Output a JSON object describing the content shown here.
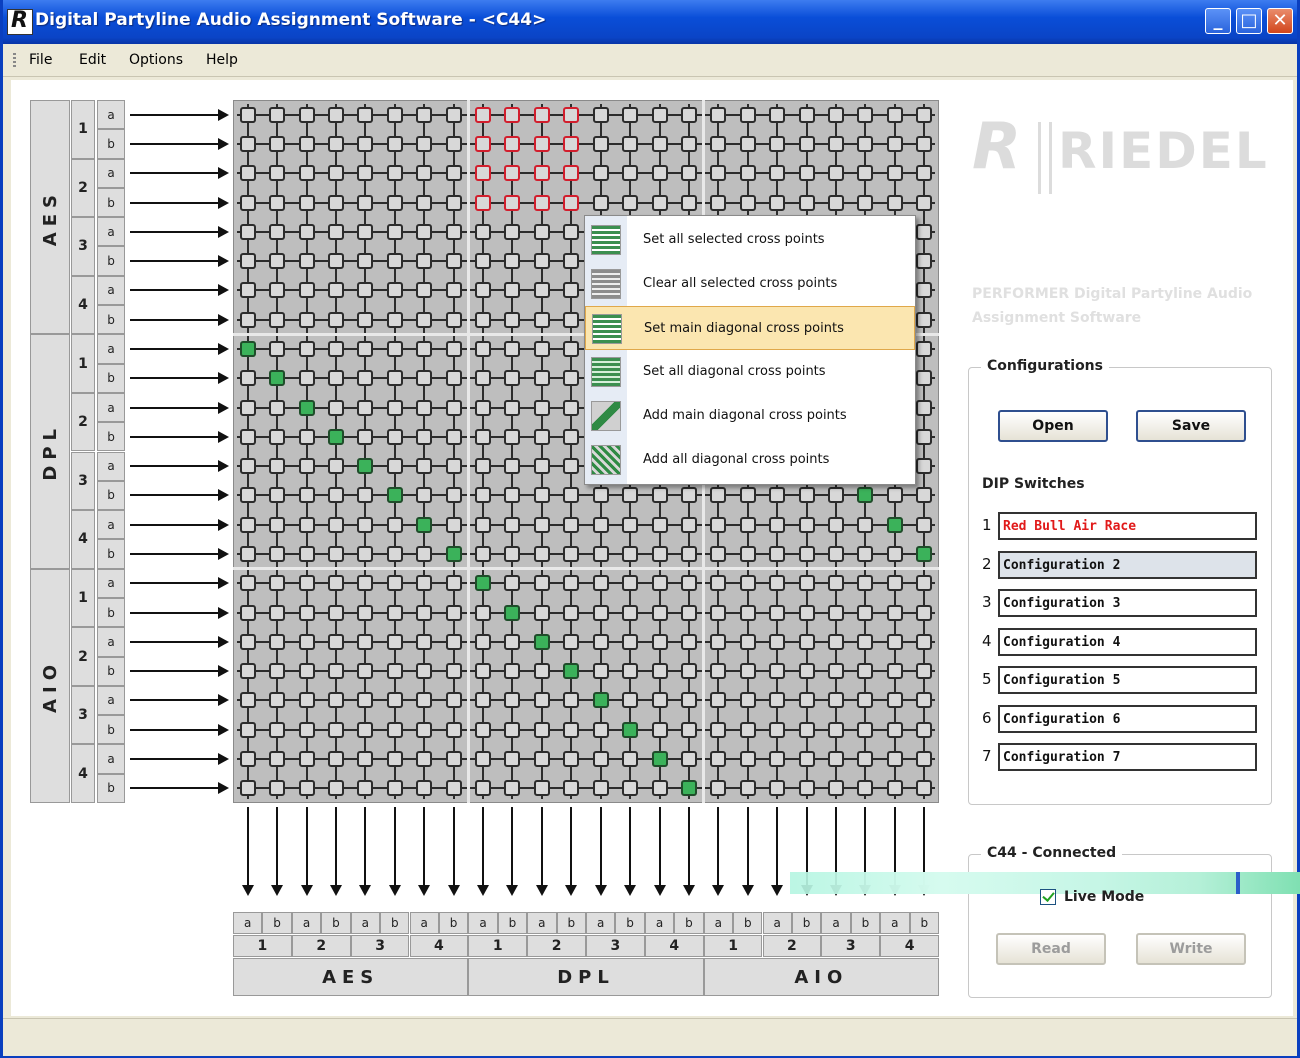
{
  "window": {
    "title": "Digital Partyline Audio Assignment Software - <C44>",
    "minimize_glyph": "_",
    "maximize_glyph": "□",
    "close_glyph": "✕",
    "app_icon_glyph": "R"
  },
  "menu": {
    "items": [
      "File",
      "Edit",
      "Options",
      "Help"
    ]
  },
  "matrix": {
    "groups": [
      "AES",
      "DPL",
      "AIO"
    ],
    "channels": [
      "1",
      "2",
      "3",
      "4"
    ],
    "sub": [
      "a",
      "b"
    ],
    "rows": 24,
    "cols": 24,
    "active_points": [
      [
        8,
        0
      ],
      [
        9,
        1
      ],
      [
        10,
        2
      ],
      [
        11,
        3
      ],
      [
        12,
        4
      ],
      [
        13,
        5
      ],
      [
        14,
        6
      ],
      [
        15,
        7
      ],
      [
        16,
        8
      ],
      [
        17,
        9
      ],
      [
        18,
        10
      ],
      [
        19,
        11
      ],
      [
        20,
        12
      ],
      [
        21,
        13
      ],
      [
        22,
        14
      ],
      [
        23,
        15
      ],
      [
        13,
        21
      ],
      [
        14,
        22
      ],
      [
        15,
        23
      ]
    ],
    "selected_block": {
      "rows": [
        0,
        3
      ],
      "cols": [
        8,
        11
      ]
    },
    "selected_color": "#d21e2d",
    "active_color": "#3bb25a"
  },
  "context_menu": {
    "items": [
      {
        "label": "Set all selected cross points",
        "icon": "set-selected-icon"
      },
      {
        "label": "Clear all selected cross points",
        "icon": "clear-selected-icon"
      },
      {
        "label": "Set main diagonal cross points",
        "icon": "set-main-diagonal-icon",
        "highlighted": true
      },
      {
        "label": "Set all diagonal cross points",
        "icon": "set-all-diagonal-icon"
      },
      {
        "label": "Add main diagonal cross points",
        "icon": "add-main-diagonal-icon"
      },
      {
        "label": "Add all diagonal cross points",
        "icon": "add-all-diagonal-icon"
      }
    ]
  },
  "logo": {
    "mark": "R",
    "text": "RIEDEL"
  },
  "tagline": "PERFORMER Digital Partyline Audio Assignment Software",
  "configurations": {
    "legend": "Configurations",
    "open_label": "Open",
    "save_label": "Save",
    "dip_label": "DIP Switches",
    "dip": [
      {
        "num": "1",
        "value": "Red Bull Air Race",
        "red": true
      },
      {
        "num": "2",
        "value": "Configuration 2",
        "selected": true
      },
      {
        "num": "3",
        "value": "Configuration 3"
      },
      {
        "num": "4",
        "value": "Configuration 4"
      },
      {
        "num": "5",
        "value": "Configuration 5"
      },
      {
        "num": "6",
        "value": "Configuration 6"
      },
      {
        "num": "7",
        "value": "Configuration 7"
      }
    ]
  },
  "connection": {
    "legend": "C44 - Connected",
    "live_mode_label": "Live Mode",
    "live_mode_checked": true,
    "read_label": "Read",
    "write_label": "Write"
  }
}
